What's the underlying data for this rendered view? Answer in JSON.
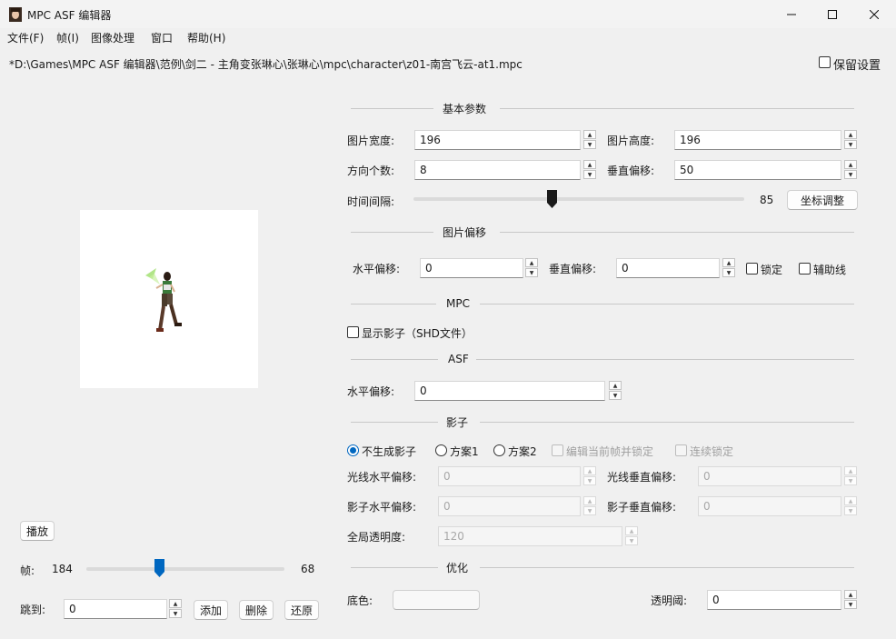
{
  "window": {
    "title": "MPC ASF 编辑器",
    "minimize": "—",
    "maximize": "☐",
    "close": "✕"
  },
  "menu": [
    "文件(F)",
    "帧(I)",
    "图像处理",
    "窗口",
    "帮助(H)"
  ],
  "path": "*D:\\Games\\MPC ASF 编辑器\\范例\\剑二 - 主角变张琳心\\张琳心\\mpc\\character\\z01-南宫飞云-at1.mpc",
  "keep_settings": {
    "label": "保留设置",
    "checked": false
  },
  "sections": {
    "basic": "基本参数",
    "image_offset": "图片偏移",
    "mpc": "MPC",
    "asf": "ASF",
    "shadow": "影子",
    "optimize": "优化"
  },
  "basic": {
    "width_label": "图片宽度:",
    "width_value": "196",
    "height_label": "图片高度:",
    "height_value": "196",
    "directions_label": "方向个数:",
    "directions_value": "8",
    "voffset_label": "垂直偏移:",
    "voffset_value": "50",
    "interval_label": "时间间隔:",
    "interval_value": "85",
    "interval_fraction": 0.42,
    "coord_button": "坐标调整"
  },
  "image_offset": {
    "h_label": "水平偏移:",
    "h_value": "0",
    "v_label": "垂直偏移:",
    "v_value": "0",
    "lock_label": "锁定",
    "guide_label": "辅助线"
  },
  "mpc": {
    "show_shadow_label": "显示影子（SHD文件）"
  },
  "asf": {
    "h_label": "水平偏移:",
    "h_value": "0"
  },
  "shadow": {
    "options": [
      "不生成影子",
      "方案1",
      "方案2"
    ],
    "selected": 0,
    "edit_lock_label": "编辑当前帧并锁定",
    "continuous_lock_label": "连续锁定",
    "light_h_label": "光线水平偏移:",
    "light_h_value": "0",
    "light_v_label": "光线垂直偏移:",
    "light_v_value": "0",
    "shadow_h_label": "影子水平偏移:",
    "shadow_h_value": "0",
    "shadow_v_label": "影子垂直偏移:",
    "shadow_v_value": "0",
    "opacity_label": "全局透明度:",
    "opacity_value": "120"
  },
  "optimize": {
    "bg_label": "底色:",
    "threshold_label": "透明阈:",
    "threshold_value": "0"
  },
  "player": {
    "play_button": "播放",
    "frame_label": "帧:",
    "frame_count": "184",
    "frame_current": "68",
    "frame_fraction": 0.37,
    "jump_label": "跳到:",
    "jump_value": "0",
    "add_button": "添加",
    "delete_button": "删除",
    "restore_button": "还原"
  }
}
